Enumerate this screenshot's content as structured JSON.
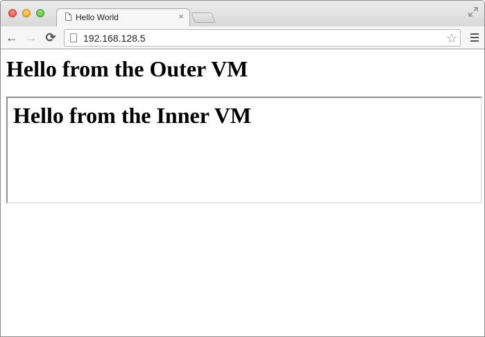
{
  "browser": {
    "tab": {
      "title": "Hello World",
      "close_glyph": "×",
      "favicon": "page-icon"
    },
    "toolbar": {
      "back_glyph": "←",
      "forward_glyph": "→",
      "reload_glyph": "⟳",
      "url": "192.168.128.5",
      "bookmark_glyph": "☆"
    },
    "icons": {
      "fullscreen": "fullscreen-icon",
      "menu": "menu-icon"
    }
  },
  "page": {
    "outer_heading": "Hello from the Outer VM",
    "inner_frame": {
      "heading": "Hello from the Inner VM"
    }
  }
}
